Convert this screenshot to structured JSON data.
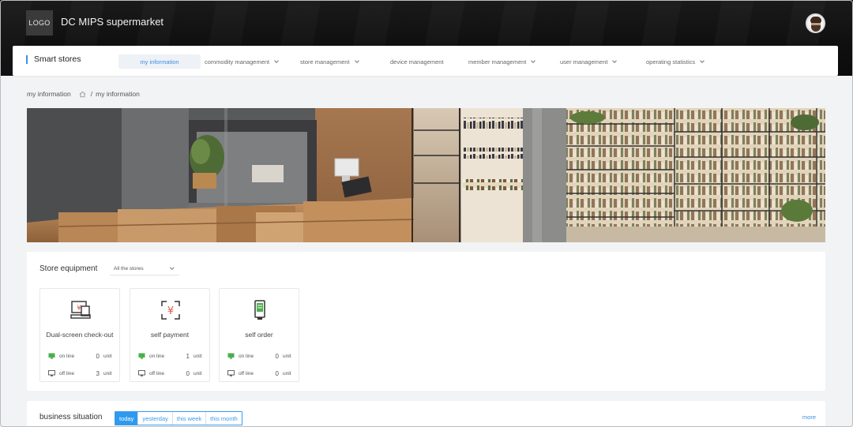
{
  "header": {
    "logo_text": "LOGO",
    "title": "DC MIPS supermarket",
    "avatar": "user-avatar"
  },
  "nav": {
    "brand": "Smart stores",
    "items": [
      {
        "label": "my information",
        "active": true,
        "dropdown": false
      },
      {
        "label": "commodity management",
        "active": false,
        "dropdown": true
      },
      {
        "label": "store management",
        "active": false,
        "dropdown": true
      },
      {
        "label": "device management",
        "active": false,
        "dropdown": false
      },
      {
        "label": "member management",
        "active": false,
        "dropdown": true
      },
      {
        "label": "user management",
        "active": false,
        "dropdown": true
      },
      {
        "label": "operating statistics",
        "active": false,
        "dropdown": true
      }
    ]
  },
  "breadcrumb": {
    "current_title": "my information",
    "separator": "/",
    "path": "my information"
  },
  "equipment": {
    "title": "Store equipment",
    "store_select": "All the stores",
    "devices": [
      {
        "name": "Dual-screen check-out",
        "icon": "dual-screen-register-icon",
        "online_label": "on line",
        "online": "0",
        "offline_label": "off line",
        "offline": "3",
        "unit": "unit"
      },
      {
        "name": "self payment",
        "icon": "scan-yen-icon",
        "online_label": "on line",
        "online": "1",
        "offline_label": "off line",
        "offline": "0",
        "unit": "unit"
      },
      {
        "name": "self order",
        "icon": "kiosk-icon",
        "online_label": "on line",
        "online": "0",
        "offline_label": "off line",
        "offline": "0",
        "unit": "unit"
      }
    ]
  },
  "business": {
    "title": "business situation",
    "tabs": [
      "today",
      "yesterday",
      "this week",
      "this month"
    ],
    "active_tab": "today",
    "more": "more"
  },
  "colors": {
    "accent": "#3d8ee8",
    "header_bg": "#111111",
    "active_tab_bg": "#2e9aef",
    "icon_red": "#e05a3a",
    "icon_green": "#4cae4c"
  }
}
